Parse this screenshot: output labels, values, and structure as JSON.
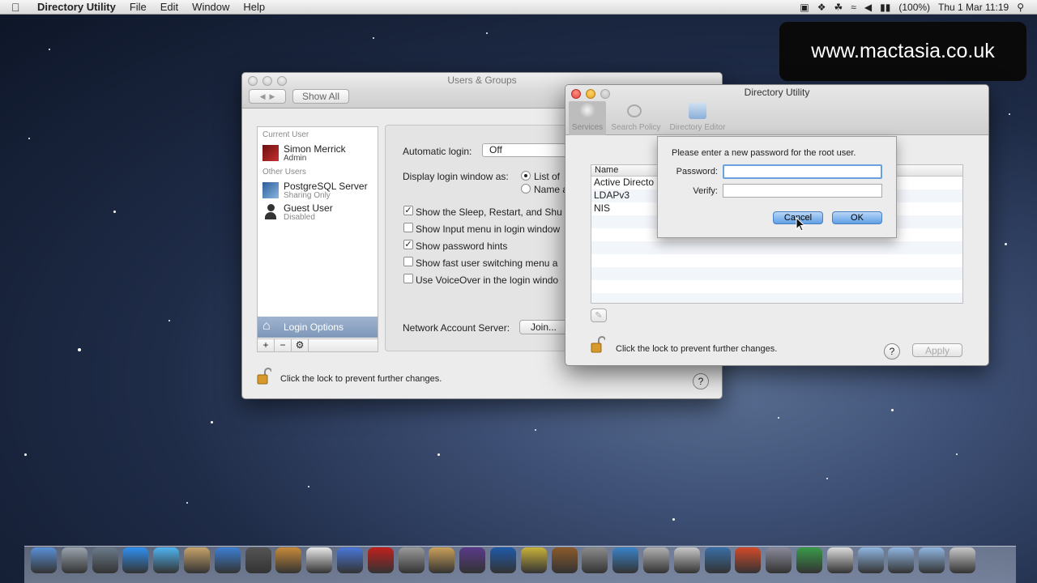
{
  "menubar": {
    "app_name": "Directory Utility",
    "items": [
      "File",
      "Edit",
      "Window",
      "Help"
    ],
    "battery": "(100%)",
    "datetime": "Thu 1 Mar  11:19"
  },
  "watermark": "www.mactasia.co.uk",
  "users_groups": {
    "title": "Users & Groups",
    "show_all": "Show All",
    "current_user_header": "Current User",
    "current_user": {
      "name": "Simon Merrick",
      "role": "Admin"
    },
    "other_users_header": "Other Users",
    "other_users": [
      {
        "name": "PostgreSQL Server",
        "role": "Sharing Only"
      },
      {
        "name": "Guest User",
        "role": "Disabled"
      }
    ],
    "login_options": "Login Options",
    "auto_login_label": "Automatic login:",
    "auto_login_value": "Off",
    "display_login_label": "Display login window as:",
    "display_opt1": "List of",
    "display_opt2": "Name a",
    "checkboxes": [
      {
        "label": "Show the Sleep, Restart, and Shu",
        "checked": true
      },
      {
        "label": "Show Input menu in login window",
        "checked": false
      },
      {
        "label": "Show password hints",
        "checked": true
      },
      {
        "label": "Show fast user switching menu a",
        "checked": false
      },
      {
        "label": "Use VoiceOver in the login windo",
        "checked": false
      }
    ],
    "network_label": "Network Account Server:",
    "join_button": "Join...",
    "lock_text": "Click the lock to prevent further changes.",
    "add": "+",
    "remove": "−"
  },
  "directory_utility": {
    "title": "Directory Utility",
    "tabs": [
      "Services",
      "Search Policy",
      "Directory Editor"
    ],
    "column_name": "Name",
    "services": [
      "Active Directo",
      "LDAPv3",
      "NIS"
    ],
    "lock_text": "Click the lock to prevent further changes.",
    "apply": "Apply",
    "help": "?"
  },
  "dialog": {
    "prompt": "Please enter a new password for the root user.",
    "password_label": "Password:",
    "verify_label": "Verify:",
    "password_value": "",
    "verify_value": "",
    "cancel": "Cancel",
    "ok": "OK"
  },
  "dock_icons": [
    "finder-icon",
    "launchpad-icon",
    "mission-control-icon",
    "app-store-icon",
    "messages-icon",
    "preview-icon",
    "safari-icon",
    "facetime-icon",
    "contacts-icon",
    "calendar-icon",
    "itunes-icon",
    "photo-booth-icon",
    "automator-icon",
    "iphoto-icon",
    "logic-icon",
    "photoshop-icon",
    "imovie-icon",
    "garageband-icon",
    "system-preferences-icon",
    "xcode-icon",
    "script-editor-icon",
    "migration-icon",
    "remote-desktop-icon",
    "presentation-icon",
    "instruments-icon",
    "numbers-icon",
    "console-icon",
    "applications-folder-icon",
    "documents-folder-icon",
    "downloads-folder-icon",
    "trash-icon"
  ]
}
